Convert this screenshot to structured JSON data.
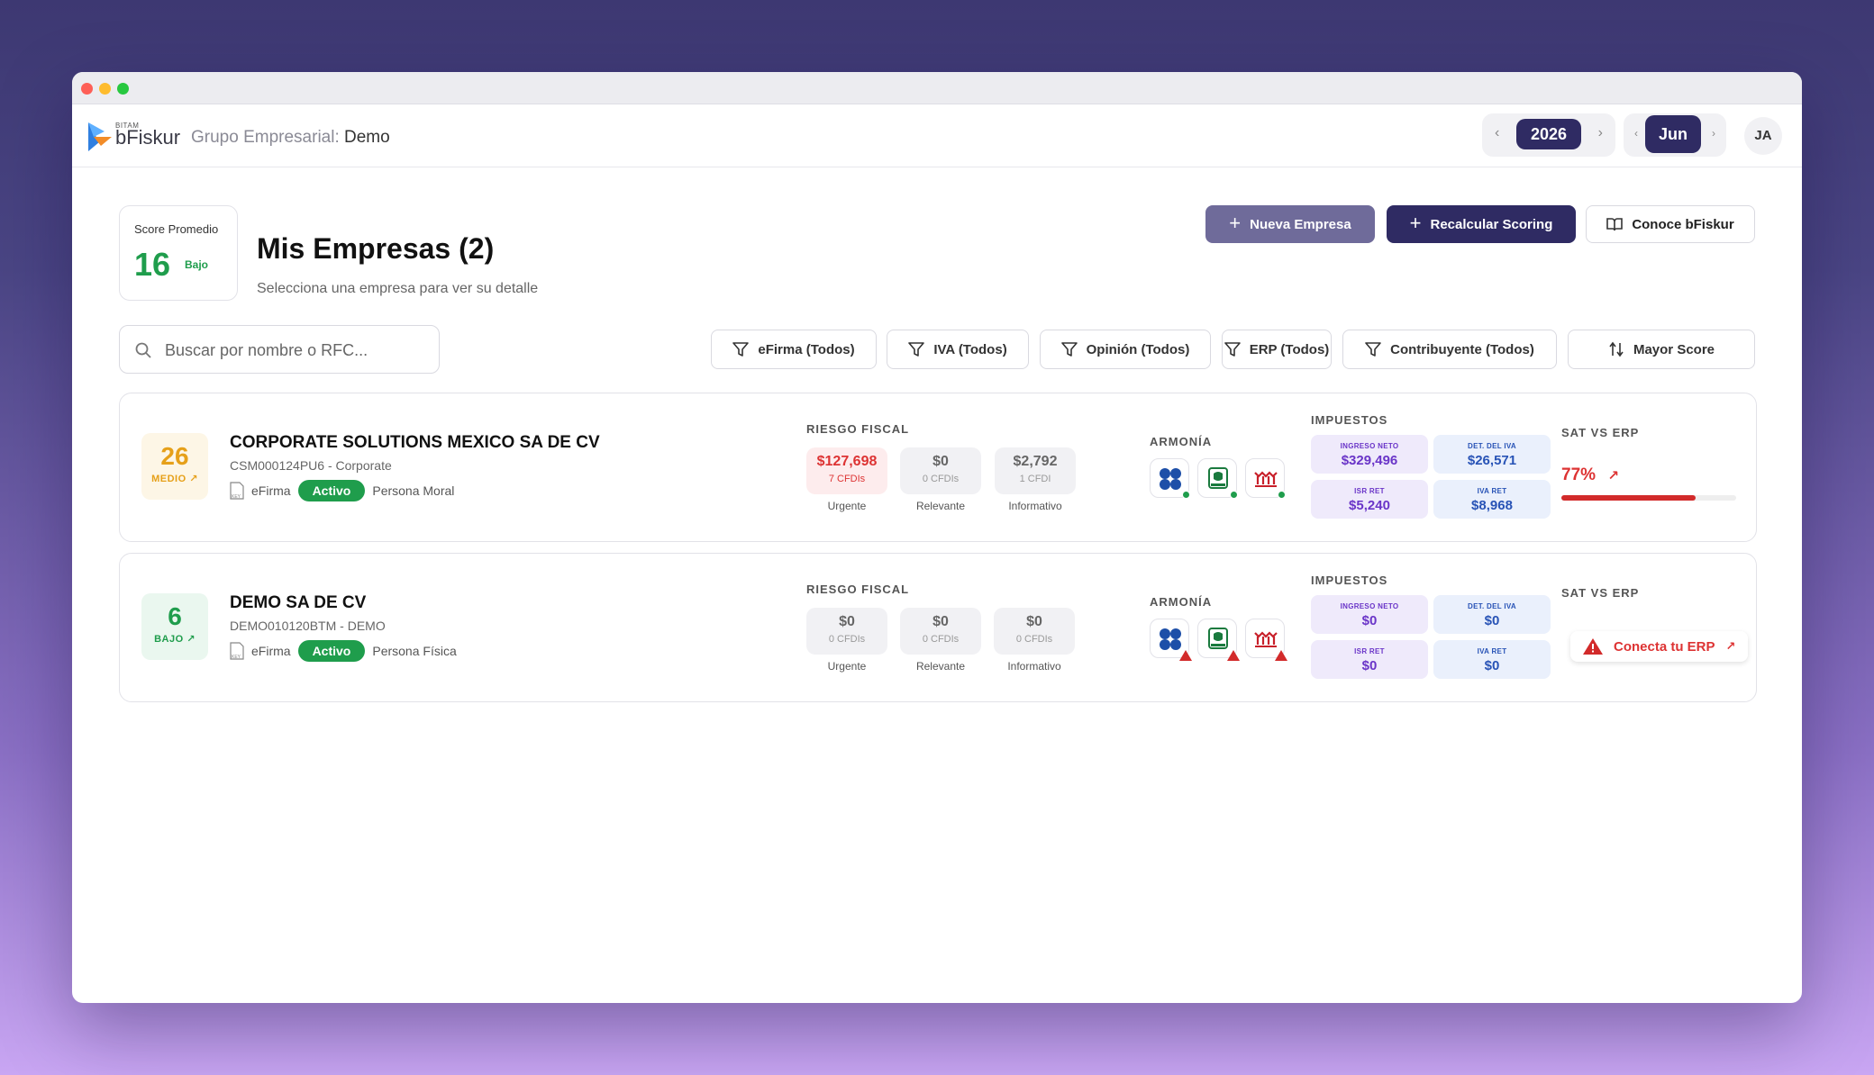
{
  "app": {
    "brand_small": "BITAM",
    "brand": "bFiskur",
    "group_label": "Grupo Empresarial:",
    "group_value": "Demo"
  },
  "period": {
    "year": "2026",
    "month": "Jun"
  },
  "user": {
    "initials": "JA"
  },
  "summary": {
    "label": "Score Promedio",
    "score": "16",
    "level": "Bajo"
  },
  "page": {
    "title": "Mis Empresas (2)",
    "subtitle": "Selecciona una empresa para ver su detalle"
  },
  "actions": {
    "new_company": "Nueva Empresa",
    "recalc": "Recalcular Scoring",
    "learn": "Conoce bFiskur"
  },
  "search": {
    "placeholder": "Buscar por nombre o RFC...",
    "value": ""
  },
  "filters": [
    {
      "label": "eFirma (Todos)"
    },
    {
      "label": "IVA (Todos)"
    },
    {
      "label": "Opinión (Todos)"
    },
    {
      "label": "ERP (Todos)"
    },
    {
      "label": "Contribuyente (Todos)"
    }
  ],
  "sort": {
    "label": "Mayor Score"
  },
  "section_labels": {
    "risk": "RIESGO FISCAL",
    "harmony": "ARMONÍA",
    "taxes": "IMPUESTOS",
    "sat_erp": "SAT VS ERP"
  },
  "companies": [
    {
      "score": "26",
      "level": "MEDIO",
      "level_color": "#e6a019",
      "level_bg": "#fdf6e6",
      "name": "CORPORATE SOLUTIONS MEXICO SA DE CV",
      "rfc": "CSM000124PU6 - Corporate",
      "efirma": "eFirma",
      "status": "Activo",
      "person_type": "Persona Moral",
      "risk": [
        {
          "amount": "$127,698",
          "cfdis": "7 CFDIs",
          "label": "Urgente"
        },
        {
          "amount": "$0",
          "cfdis": "0 CFDIs",
          "label": "Relevante"
        },
        {
          "amount": "$2,792",
          "cfdis": "1 CFDI",
          "label": "Informativo"
        }
      ],
      "harmony_status": "ok",
      "taxes": [
        {
          "title": "INGRESO NETO",
          "amount": "$329,496"
        },
        {
          "title": "DET. DEL IVA",
          "amount": "$26,571"
        },
        {
          "title": "ISR RET",
          "amount": "$5,240"
        },
        {
          "title": "IVA RET",
          "amount": "$8,968"
        }
      ],
      "sat_vs_erp": {
        "percent": "77%",
        "fraction": 0.77
      }
    },
    {
      "score": "6",
      "level": "BAJO",
      "level_color": "#1f9d4c",
      "level_bg": "#eaf7ef",
      "name": "DEMO SA DE CV",
      "rfc": "DEMO010120BTM - DEMO",
      "efirma": "eFirma",
      "status": "Activo",
      "person_type": "Persona Física",
      "risk": [
        {
          "amount": "$0",
          "cfdis": "0 CFDIs",
          "label": "Urgente"
        },
        {
          "amount": "$0",
          "cfdis": "0 CFDIs",
          "label": "Relevante"
        },
        {
          "amount": "$0",
          "cfdis": "0 CFDIs",
          "label": "Informativo"
        }
      ],
      "harmony_status": "warning",
      "taxes": [
        {
          "title": "INGRESO NETO",
          "amount": "$0"
        },
        {
          "title": "DET. DEL IVA",
          "amount": "$0"
        },
        {
          "title": "ISR RET",
          "amount": "$0"
        },
        {
          "title": "IVA RET",
          "amount": "$0"
        }
      ],
      "sat_vs_erp": {
        "cta": "Conecta tu ERP"
      }
    }
  ]
}
